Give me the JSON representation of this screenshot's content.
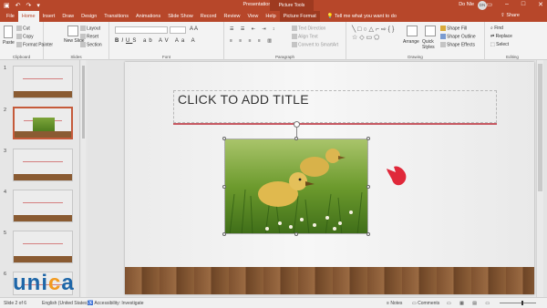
{
  "window": {
    "title": "Presentation1 - PowerPoint",
    "context_tab_group": "Picture Tools",
    "user_name": "Do Nle",
    "avatar_initials": "DN"
  },
  "tabs": [
    "File",
    "Home",
    "Insert",
    "Draw",
    "Design",
    "Transitions",
    "Animations",
    "Slide Show",
    "Record",
    "Review",
    "View",
    "Help",
    "Picture Format"
  ],
  "active_tab": "Home",
  "tell_me": "Tell me what you want to do",
  "share_label": "Share",
  "ribbon": {
    "clipboard": {
      "label": "Clipboard",
      "paste": "Paste",
      "cut": "Cut",
      "copy": "Copy",
      "format_painter": "Format Painter"
    },
    "slides": {
      "label": "Slides",
      "new_slide": "New Slide",
      "layout": "Layout",
      "reset": "Reset",
      "section": "Section"
    },
    "font": {
      "label": "Font"
    },
    "paragraph": {
      "label": "Paragraph",
      "text_direction": "Text Direction",
      "align_text": "Align Text",
      "convert_smartart": "Convert to SmartArt"
    },
    "drawing": {
      "label": "Drawing",
      "arrange": "Arrange",
      "quick_styles": "Quick Styles",
      "shape_fill": "Shape Fill",
      "shape_outline": "Shape Outline",
      "shape_effects": "Shape Effects"
    },
    "editing": {
      "label": "Editing",
      "find": "Find",
      "replace": "Replace",
      "select": "Select"
    }
  },
  "thumbnails": [
    "1",
    "2",
    "3",
    "4",
    "5",
    "6"
  ],
  "slide": {
    "title_placeholder": "CLICK TO ADD TITLE"
  },
  "status": {
    "slide_of": "Slide 2 of 6",
    "language": "English (United States)",
    "accessibility": "Accessibility: Investigate",
    "notes": "Notes",
    "comments": "Comments"
  },
  "logo": {
    "u": "u",
    "ni": "ni",
    "c": "c",
    "a": "a"
  },
  "colors": {
    "accent": "#b7472a",
    "title_line": "#c65962"
  }
}
